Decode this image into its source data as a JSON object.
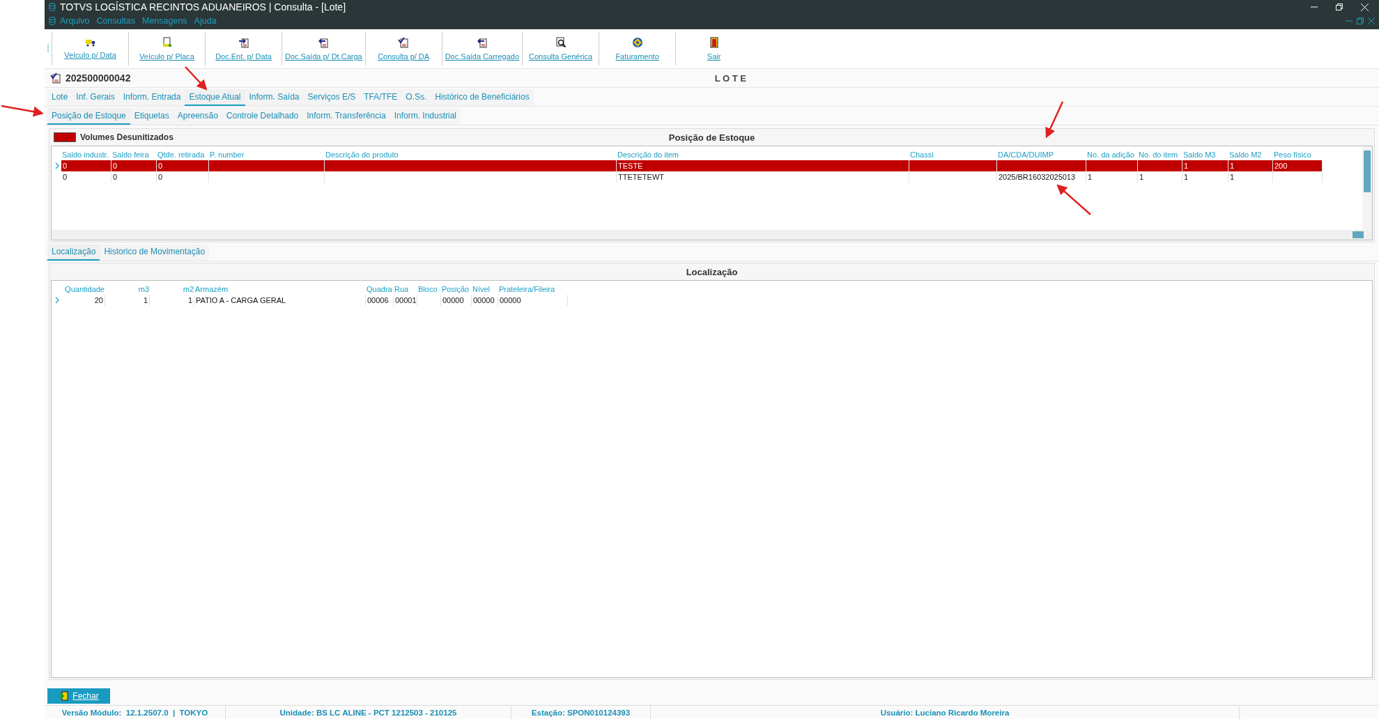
{
  "window": {
    "title": "TOTVS LOGÍSTICA RECINTOS ADUANEIROS | Consulta - [Lote]"
  },
  "menu": [
    "Arquivo",
    "Consultas",
    "Mensagens",
    "Ajuda"
  ],
  "toolbar": [
    {
      "label": "Veículo p/ Data",
      "kind": "truck"
    },
    {
      "label": "Veículo p/ Placa",
      "kind": "truckdoc"
    },
    {
      "label": "Doc.Ent. p/ Data",
      "kind": "docin"
    },
    {
      "label": "Doc.Saída p/ Dt.Carga",
      "kind": "docout"
    },
    {
      "label": "Consulta p/ DA",
      "kind": "check"
    },
    {
      "label": "Doc.Saída Carregado",
      "kind": "docout"
    },
    {
      "label": "Consulta Genérica",
      "kind": "search"
    },
    {
      "label": "Faturamento",
      "kind": "money"
    },
    {
      "label": "Sair",
      "kind": "exit"
    }
  ],
  "header": {
    "number": "202500000042",
    "title": "L O T E"
  },
  "tabs": [
    {
      "label": "Lote",
      "selected": false
    },
    {
      "label": "Inf. Gerais",
      "selected": false
    },
    {
      "label": "Inform. Entrada",
      "selected": false
    },
    {
      "label": "Estoque Atual",
      "selected": true
    },
    {
      "label": "Inform. Saída",
      "selected": false
    },
    {
      "label": "Serviços E/S",
      "selected": false
    },
    {
      "label": "TFA/TFE",
      "selected": false
    },
    {
      "label": "O.Ss.",
      "selected": false
    },
    {
      "label": "Histórico de Beneficiários",
      "selected": false
    }
  ],
  "subtabs": [
    {
      "label": "Posição de Estoque",
      "selected": true
    },
    {
      "label": "Etiquetas",
      "selected": false
    },
    {
      "label": "Apreensão",
      "selected": false
    },
    {
      "label": "Controle Detalhado",
      "selected": false
    },
    {
      "label": "Inform. Transferência",
      "selected": false
    },
    {
      "label": "Inform. Industrial",
      "selected": false
    }
  ],
  "stock_panel": {
    "legend": {
      "label": "Volumes Desunitizados",
      "color": "#c00000"
    },
    "title": "Posição de Estoque",
    "columns": [
      "Saldo industr.",
      "Saldo feira",
      "Qtde. retirada",
      "P. number",
      "Descrição do produto",
      "Descrição do item",
      "Chassi",
      "DA/CDA/DUIMP",
      "No. da adição",
      "No. do item",
      "Saldo M3",
      "Saldo M2",
      "Peso físico"
    ],
    "rows": [
      {
        "selected": true,
        "desunitized": true,
        "cells": [
          "0",
          "0",
          "0",
          "",
          "",
          "TESTE",
          "",
          "",
          "",
          "",
          "1",
          "1",
          "200"
        ]
      },
      {
        "selected": false,
        "desunitized": false,
        "cells": [
          "0",
          "0",
          "0",
          "",
          "",
          "TTETETEWT",
          "",
          "2025/BR16032025013",
          "1",
          "1",
          "1",
          "1",
          ""
        ]
      }
    ]
  },
  "bottom_tabs": [
    {
      "label": "Localização",
      "selected": true
    },
    {
      "label": "Historico de Movimentação",
      "selected": false
    }
  ],
  "location_panel": {
    "title": "Localização",
    "columns": [
      "Quantidade",
      "m3",
      "m2",
      "Armazém",
      "Quadra",
      "Rua",
      "Bloco",
      "Posição",
      "Nível",
      "Prateleira/Fileira"
    ],
    "rows": [
      {
        "selected": true,
        "cells": [
          "20",
          "1",
          "1",
          "PATIO A - CARGA GERAL",
          "00006",
          "00001",
          "",
          "00000",
          "00000",
          "00000"
        ]
      }
    ]
  },
  "close_button": "Fechar",
  "status_bar": [
    "Versão Módulo:  12.1.2507.0  |  TOKYO",
    "Unidade: BS LC ALINE - PCT 1212503 - 210125",
    "Estação: SPON010124393",
    "Usuário: Luciano Ricardo Moreira"
  ]
}
